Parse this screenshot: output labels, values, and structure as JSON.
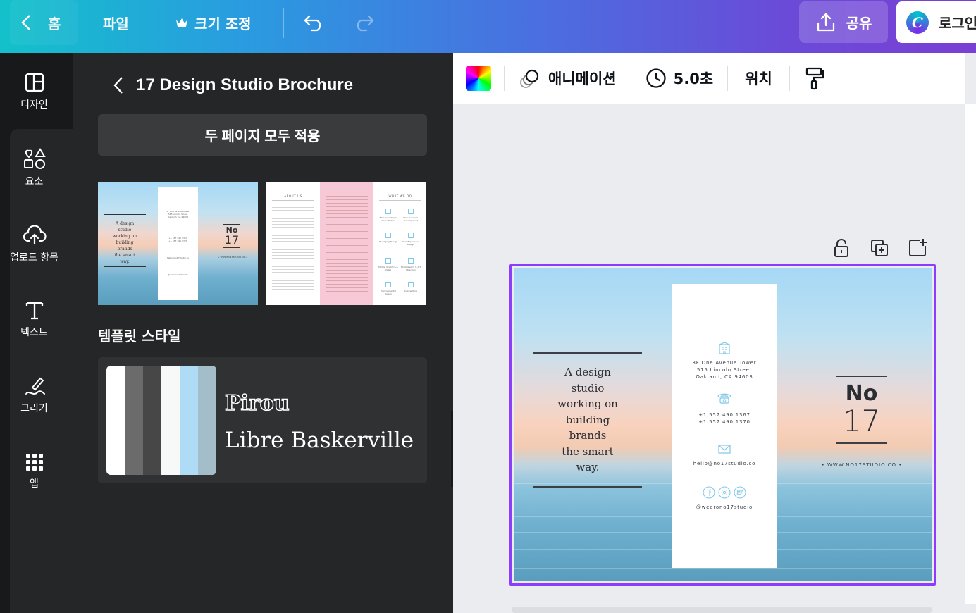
{
  "topbar": {
    "home": "홈",
    "file": "파일",
    "resize": "크기 조정",
    "share": "공유",
    "login": "로그인",
    "logo_letter": "C",
    "gradient_from": "#13c1cb",
    "gradient_to": "#7a3fd4"
  },
  "rail": {
    "items": [
      {
        "label": "디자인",
        "icon": "layout-icon"
      },
      {
        "label": "요소",
        "icon": "shapes-icon"
      },
      {
        "label": "업로드 항목",
        "icon": "cloud-upload-icon"
      },
      {
        "label": "텍스트",
        "icon": "text-icon"
      },
      {
        "label": "그리기",
        "icon": "draw-icon"
      },
      {
        "label": "앱",
        "icon": "apps-grid-icon"
      }
    ]
  },
  "panel": {
    "title": "17 Design Studio Brochure",
    "apply_button": "두 페이지 모두 적용",
    "style_title": "템플릿 스타일",
    "font_primary": "Pirou",
    "font_secondary": "Libre Baskerville",
    "palette": [
      "#ffffff",
      "#6b6b6b",
      "#474747",
      "#f6f9f8",
      "#aedcf7",
      "#a3bdc9"
    ]
  },
  "toolbar": {
    "animation": "애니메이션",
    "duration": "5.0초",
    "position": "위치"
  },
  "page": {
    "tagline_lines": [
      "A design",
      "studio",
      "working on",
      "building",
      "brands",
      "the smart",
      "way."
    ],
    "address_lines": [
      "3F One Avenue Tower",
      "515 Lincoln Street",
      "Oakland, CA 94603"
    ],
    "phone_lines": [
      "+1 557 490 1367",
      "+1 557 490 1370"
    ],
    "email": "hello@no17studio.co",
    "social_handle": "@wearono17studio",
    "number_label": "No",
    "number": "17",
    "website": "• WWW.NO17STUDIO.CO •",
    "accent_color": "#8b3dff"
  },
  "thumb2": {
    "about_title": "ABOUT US",
    "what_title": "WHAT WE DO",
    "services": [
      "Brand Identity & Consultation",
      "Web Design & Development",
      "Packaging Design",
      "User Experience Design",
      "Motion Graphics & Video",
      "Photography & Art Direction",
      "Environmental Design",
      "Copywriting"
    ]
  }
}
